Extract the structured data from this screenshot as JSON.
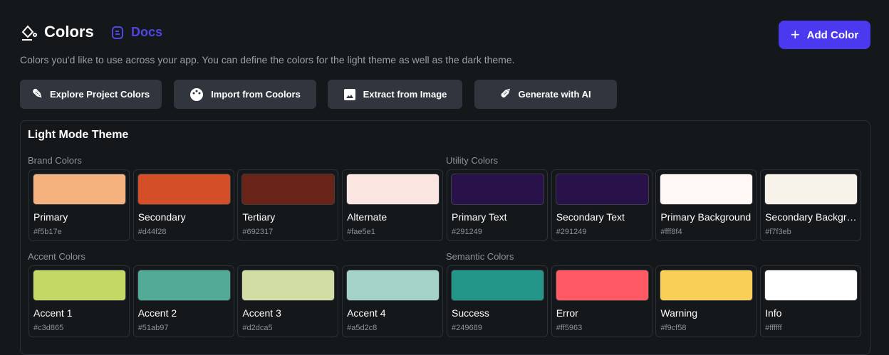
{
  "header": {
    "title": "Colors",
    "docs_label": "Docs",
    "description": "Colors you'd like to use across your app. You can define the colors for the light theme as well as the dark theme.",
    "add_label": "Add Color",
    "accent": "#4b39ef"
  },
  "toolbar": [
    {
      "label": "Explore Project Colors",
      "icon": "tools-icon"
    },
    {
      "label": "Import from Coolors",
      "icon": "palette-icon"
    },
    {
      "label": "Extract from Image",
      "icon": "image-icon"
    },
    {
      "label": "Generate with AI",
      "icon": "ai-draw-icon"
    }
  ],
  "panel": {
    "title": "Light Mode Theme",
    "sections": [
      {
        "label": "Brand Colors",
        "colors": [
          {
            "name": "Primary",
            "hex": "#f5b17e"
          },
          {
            "name": "Secondary",
            "hex": "#d44f28"
          },
          {
            "name": "Tertiary",
            "hex": "#692317"
          },
          {
            "name": "Alternate",
            "hex": "#fae5e1"
          }
        ]
      },
      {
        "label": "Utility Colors",
        "colors": [
          {
            "name": "Primary Text",
            "hex": "#291249"
          },
          {
            "name": "Secondary Text",
            "hex": "#291249"
          },
          {
            "name": "Primary Background",
            "hex": "#fff8f4"
          },
          {
            "name": "Secondary Background",
            "hex": "#f7f3eb"
          }
        ]
      },
      {
        "label": "Accent Colors",
        "colors": [
          {
            "name": "Accent 1",
            "hex": "#c3d865"
          },
          {
            "name": "Accent 2",
            "hex": "#51ab97"
          },
          {
            "name": "Accent 3",
            "hex": "#d2dca5"
          },
          {
            "name": "Accent 4",
            "hex": "#a5d2c8"
          }
        ]
      },
      {
        "label": "Semantic Colors",
        "colors": [
          {
            "name": "Success",
            "hex": "#249689"
          },
          {
            "name": "Error",
            "hex": "#ff5963"
          },
          {
            "name": "Warning",
            "hex": "#f9cf58"
          },
          {
            "name": "Info",
            "hex": "#ffffff"
          }
        ]
      }
    ]
  }
}
